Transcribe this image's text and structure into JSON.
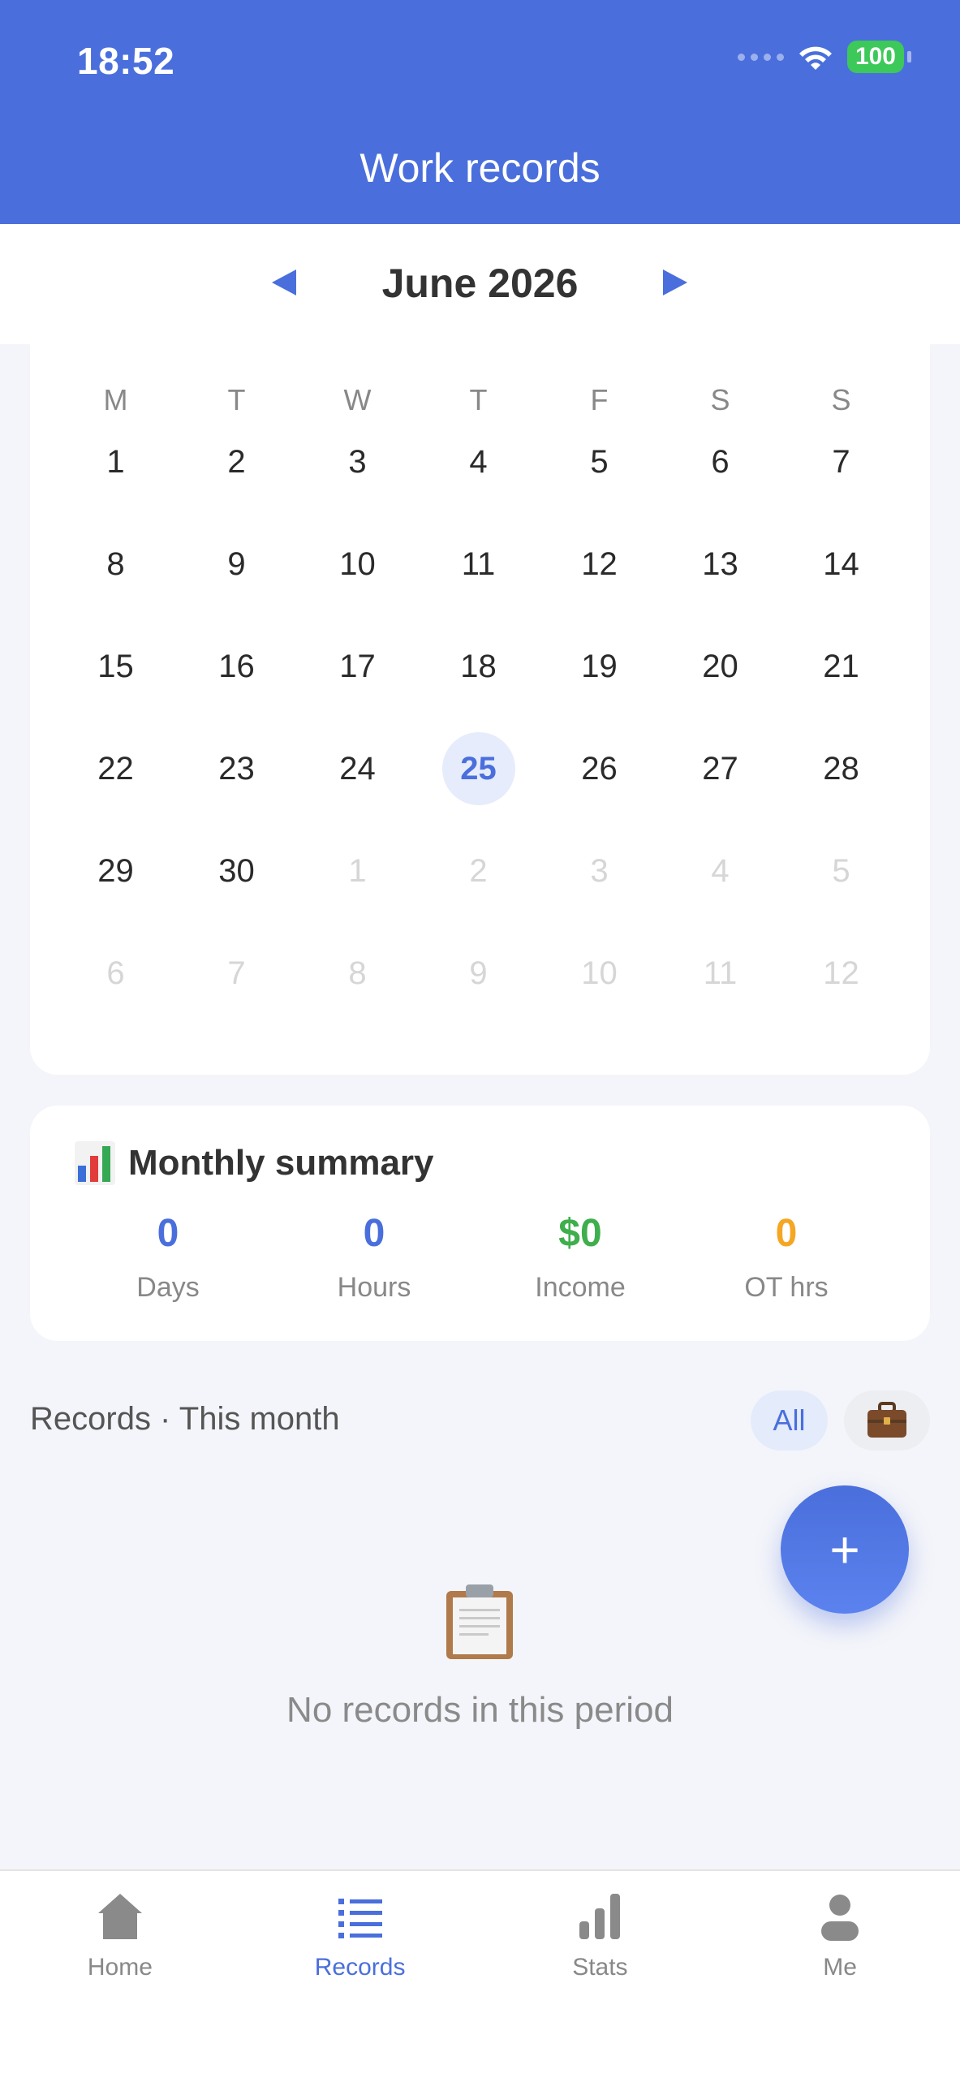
{
  "status": {
    "time": "18:52",
    "battery": "100",
    "icons": [
      "signal-dots-icon",
      "wifi-icon",
      "battery-icon"
    ]
  },
  "header": {
    "title": "Work records"
  },
  "month": {
    "label": "June 2026",
    "prev_icon": "left-triangle-icon",
    "next_icon": "right-triangle-icon"
  },
  "calendar": {
    "weekdays": [
      "M",
      "T",
      "W",
      "T",
      "F",
      "S",
      "S"
    ],
    "rows": [
      [
        {
          "d": "1"
        },
        {
          "d": "2"
        },
        {
          "d": "3"
        },
        {
          "d": "4"
        },
        {
          "d": "5"
        },
        {
          "d": "6"
        },
        {
          "d": "7"
        }
      ],
      [
        {
          "d": "8"
        },
        {
          "d": "9"
        },
        {
          "d": "10"
        },
        {
          "d": "11"
        },
        {
          "d": "12"
        },
        {
          "d": "13"
        },
        {
          "d": "14"
        }
      ],
      [
        {
          "d": "15"
        },
        {
          "d": "16"
        },
        {
          "d": "17"
        },
        {
          "d": "18"
        },
        {
          "d": "19"
        },
        {
          "d": "20"
        },
        {
          "d": "21"
        }
      ],
      [
        {
          "d": "22"
        },
        {
          "d": "23"
        },
        {
          "d": "24"
        },
        {
          "d": "25",
          "today": true
        },
        {
          "d": "26"
        },
        {
          "d": "27"
        },
        {
          "d": "28"
        }
      ],
      [
        {
          "d": "29"
        },
        {
          "d": "30"
        },
        {
          "d": "1",
          "muted": true
        },
        {
          "d": "2",
          "muted": true
        },
        {
          "d": "3",
          "muted": true
        },
        {
          "d": "4",
          "muted": true
        },
        {
          "d": "5",
          "muted": true
        }
      ],
      [
        {
          "d": "6",
          "muted": true
        },
        {
          "d": "7",
          "muted": true
        },
        {
          "d": "8",
          "muted": true
        },
        {
          "d": "9",
          "muted": true
        },
        {
          "d": "10",
          "muted": true
        },
        {
          "d": "11",
          "muted": true
        },
        {
          "d": "12",
          "muted": true
        }
      ]
    ]
  },
  "summary": {
    "title": "Monthly summary",
    "icon": "bar-chart-icon",
    "stats": [
      {
        "value": "0",
        "label": "Days",
        "color": "#4a6fdc"
      },
      {
        "value": "0",
        "label": "Hours",
        "color": "#4a6fdc"
      },
      {
        "value": "$0",
        "label": "Income",
        "color": "#3fae4c"
      },
      {
        "value": "0",
        "label": "OT hrs",
        "color": "#f5a623"
      }
    ]
  },
  "records": {
    "label": "Records · This month",
    "filter_all": "All",
    "filter_work_icon": "briefcase-icon",
    "add_label": "+",
    "empty_icon": "clipboard-icon",
    "empty_text": "No records in this period"
  },
  "tabbar": {
    "items": [
      {
        "label": "Home",
        "icon": "home-icon"
      },
      {
        "label": "Records",
        "icon": "list-icon",
        "active": true
      },
      {
        "label": "Stats",
        "icon": "stats-icon"
      },
      {
        "label": "Me",
        "icon": "person-icon"
      }
    ]
  },
  "colors": {
    "accent": "#4a6fdc",
    "income": "#3fae4c",
    "overtime": "#f5a623",
    "background": "#f4f5fa"
  }
}
